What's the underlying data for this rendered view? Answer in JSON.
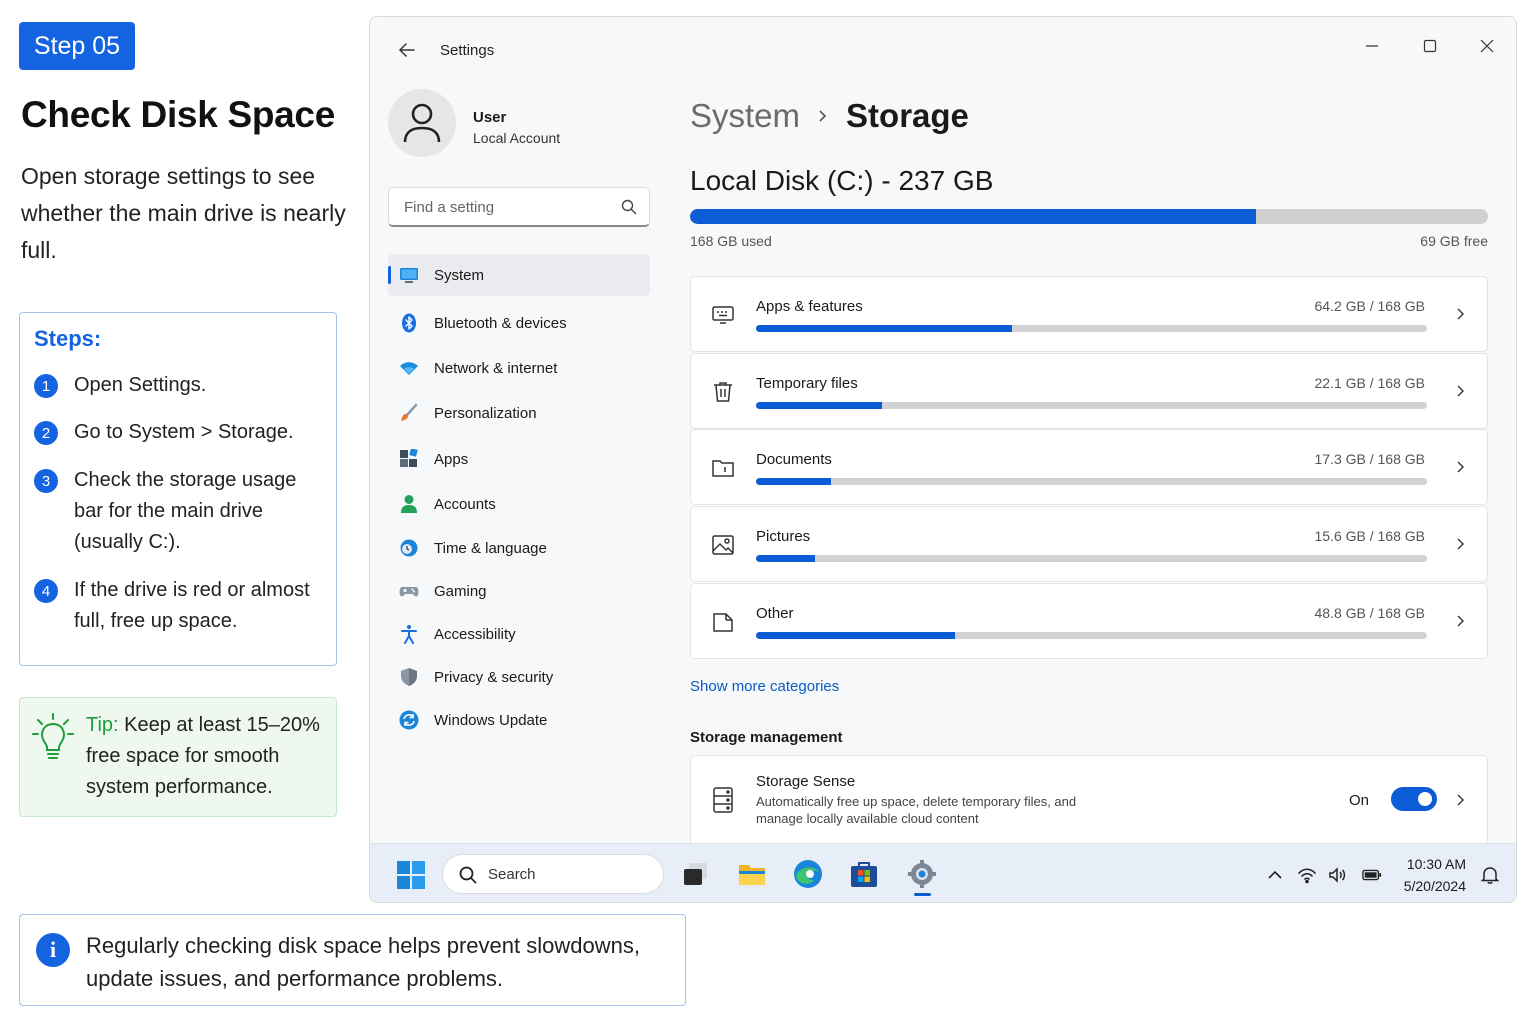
{
  "guide": {
    "step_badge": "Step 05",
    "title": "Check Disk Space",
    "description": "Open storage settings to see whether the main drive is nearly full.",
    "steps_title": "Steps:",
    "steps": [
      {
        "num": "1",
        "text": "Open Settings."
      },
      {
        "num": "2",
        "text": "Go to System > Storage."
      },
      {
        "num": "3",
        "text": "Check the storage usage bar for the main drive (usually C:)."
      },
      {
        "num": "4",
        "text": "If the drive is red or almost full, free up space."
      }
    ],
    "tip_label": "Tip:",
    "tip_text": " Keep at least 15–20% free space for smooth system performance.",
    "info_icon": "i",
    "info_text": "Regularly checking disk space helps prevent slowdowns, update issues, and performance problems."
  },
  "window": {
    "title": "Settings",
    "user": {
      "name": "User",
      "account": "Local Account"
    },
    "search_placeholder": "Find a setting",
    "nav": [
      {
        "label": "System",
        "icon": "monitor-icon",
        "active": true
      },
      {
        "label": "Bluetooth & devices",
        "icon": "bluetooth-icon"
      },
      {
        "label": "Network & internet",
        "icon": "wifi-icon"
      },
      {
        "label": "Personalization",
        "icon": "brush-icon"
      },
      {
        "label": "Apps",
        "icon": "apps-icon"
      },
      {
        "label": "Accounts",
        "icon": "person-icon"
      },
      {
        "label": "Time & language",
        "icon": "globe-clock-icon"
      },
      {
        "label": "Gaming",
        "icon": "gamepad-icon"
      },
      {
        "label": "Accessibility",
        "icon": "accessibility-icon"
      },
      {
        "label": "Privacy & security",
        "icon": "shield-icon"
      },
      {
        "label": "Windows Update",
        "icon": "update-icon"
      }
    ],
    "breadcrumb": {
      "parent": "System",
      "current": "Storage"
    },
    "disk": {
      "title": "Local Disk (C:) - 237 GB",
      "used_label": "168 GB used",
      "free_label": "69 GB free",
      "used_fraction": 0.709
    },
    "categories": [
      {
        "name": "Apps & features",
        "size": "64.2 GB / 168 GB",
        "fraction": 0.382,
        "icon": "apps-features-icon"
      },
      {
        "name": "Temporary files",
        "size": "22.1 GB / 168 GB",
        "fraction": 0.188,
        "icon": "trash-icon"
      },
      {
        "name": "Documents",
        "size": "17.3 GB / 168 GB",
        "fraction": 0.112,
        "icon": "folder-icon"
      },
      {
        "name": "Pictures",
        "size": "15.6 GB / 168 GB",
        "fraction": 0.088,
        "icon": "image-icon"
      },
      {
        "name": "Other",
        "size": "48.8 GB / 168 GB",
        "fraction": 0.296,
        "icon": "other-icon"
      }
    ],
    "show_more": "Show more categories",
    "storage_management_title": "Storage management",
    "storage_sense": {
      "name": "Storage Sense",
      "description": "Automatically free up space, delete temporary files, and manage locally available cloud content",
      "state": "On"
    }
  },
  "taskbar": {
    "search_label": "Search",
    "time": "10:30 AM",
    "date": "5/20/2024"
  },
  "colors": {
    "accent": "#0b5cd5",
    "badge": "#1463e0",
    "tip_green": "#1f9d3a"
  }
}
